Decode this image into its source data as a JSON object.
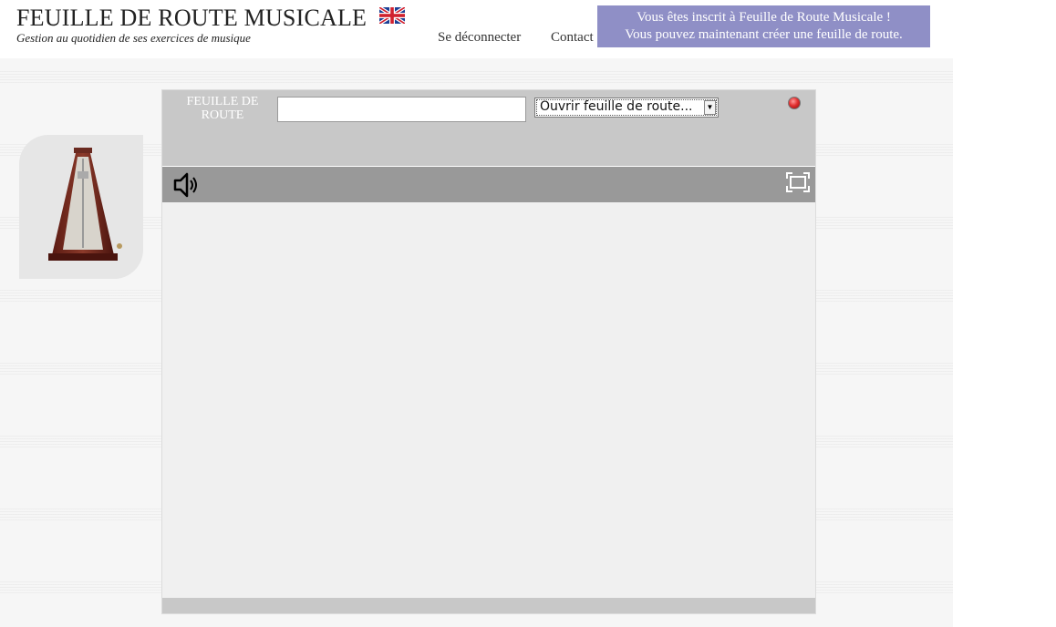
{
  "header": {
    "title": "FEUILLE DE ROUTE MUSICALE",
    "subtitle": "Gestion au quotidien de ses exercices de musique",
    "language_flag_icon": "uk-flag-icon"
  },
  "nav": {
    "logout": "Se déconnecter",
    "contact": "Contact"
  },
  "notice": {
    "line1": "Vous êtes inscrit à Feuille de Route Musicale !",
    "line2": "Vous pouvez maintenant créer une feuille de route.",
    "color": "#8f8fc6"
  },
  "sidebar": {
    "image_icon": "metronome-icon"
  },
  "roadmap_bar": {
    "label_line1": "FEUILLE DE",
    "label_line2": "ROUTE",
    "input_value": "",
    "input_placeholder": "",
    "select_value": "Ouvrir feuille de route...",
    "close_icon": "red-dot-icon"
  },
  "toolbar": {
    "sound_icon": "speaker-icon",
    "fullscreen_icon": "fullscreen-icon"
  },
  "colors": {
    "panel_bg": "#f0f0f0",
    "top_bar": "#c8c8c8",
    "tool_bar": "#999999"
  }
}
